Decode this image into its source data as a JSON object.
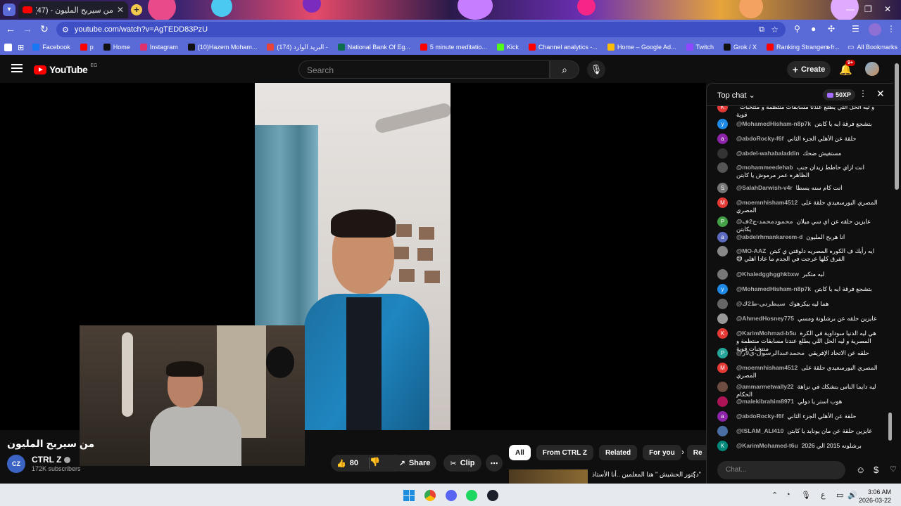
{
  "browser": {
    "tab_title": "من سيربح المليون - ube (47)",
    "url": "youtube.com/watch?v=AgTEDD83PzU",
    "bookmarks": [
      {
        "label": "Facebook",
        "color": "#1877f2"
      },
      {
        "label": "p",
        "color": "#ff0000"
      },
      {
        "label": "Home",
        "color": "#111111"
      },
      {
        "label": "Instagram",
        "color": "#e1306c"
      },
      {
        "label": "(10)Hazem Moham...",
        "color": "#111111"
      },
      {
        "label": "البريد الوارد (174) -",
        "color": "#ea4335"
      },
      {
        "label": "National Bank Of Eg...",
        "color": "#0b6e4f"
      },
      {
        "label": "5 minute meditatio...",
        "color": "#ff0000"
      },
      {
        "label": "Kick",
        "color": "#53fc18"
      },
      {
        "label": "Channel analytics -...",
        "color": "#ff0000"
      },
      {
        "label": "Home – Google Ad...",
        "color": "#fbbc05"
      },
      {
        "label": "Twitch",
        "color": "#9146ff"
      },
      {
        "label": "Grok / X",
        "color": "#111111"
      },
      {
        "label": "Ranking Strangers fr...",
        "color": "#ff0000"
      }
    ],
    "all_bookmarks": "All Bookmarks"
  },
  "youtube": {
    "logo_text": "YouTube",
    "country_code": "EG",
    "search_placeholder": "Search",
    "create_label": "Create",
    "notif_count": "9+"
  },
  "video": {
    "title": "من سيربح المليون",
    "channel_name": "CTRL Z",
    "channel_initials": "CZ",
    "subscribers": "172K subscribers",
    "likes": "80",
    "share_label": "Share",
    "clip_label": "Clip"
  },
  "chips": [
    "All",
    "From CTRL Z",
    "Related",
    "For you",
    "Re"
  ],
  "recommendation": {
    "title": "\"دكتور الحشيش \" هنا المعلمين ..أنا الأستاذ"
  },
  "chat": {
    "mode": "Top chat",
    "xp": "50XP",
    "input_placeholder": "Chat...",
    "messages": [
      {
        "user": "",
        "text": "و ليه الحل اللي يطلع عندنا مسابقات منتظمة و منتخبات قوية",
        "initial": "K",
        "color": "#e53935"
      },
      {
        "user": "@MohamedHisham-n8p7k",
        "text": "بتشجع فرقة ايه يا كابتن",
        "initial": "y",
        "color": "#1e88e5"
      },
      {
        "user": "@abdoRocky-f6f",
        "text": "حلقة عن الأهلي الجزء الثاني",
        "initial": "a",
        "color": "#8e24aa"
      },
      {
        "user": "@abdel-wahabaladdin",
        "text": "مستفيش ضحك",
        "initial": "",
        "color": "#333333"
      },
      {
        "user": "@mohammeedehab",
        "text": "انت ازاي حاطط زيدان جنب الظاهره عمر مرموش يا كابتن",
        "initial": "",
        "color": "#555555"
      },
      {
        "user": "@SalahDarwish-v4r",
        "text": "انت كام سنه يسطا",
        "initial": "S",
        "color": "#757575"
      },
      {
        "user": "@moemnhisham4512",
        "text": "المصري البورسعيدي حلقة على المصري",
        "initial": "M",
        "color": "#e53935"
      },
      {
        "user": "@محمودمحمد-ج2ف",
        "text": "عايزين حلقه عن اي سي ميلان يكابتن",
        "initial": "P",
        "color": "#43a047"
      },
      {
        "user": "@abdelrhmankareem-d",
        "text": "انا هربح المليون",
        "initial": "a",
        "color": "#5c6bc0"
      },
      {
        "user": "@MO-AAZ",
        "text": "ايه رأيك ف الكوره المصريه دلوقتي ي كبتن الفرق كلها عرجت في الجدم ما عادا اهلي 😅",
        "initial": "",
        "color": "#888888"
      },
      {
        "user": "@Khaledgghgghkbxw",
        "text": "ليه متكبر",
        "initial": "",
        "color": "#777777"
      },
      {
        "user": "@MohamedHisham-n8p7k",
        "text": "بتشجع فرقة ايه يا كابتن",
        "initial": "y",
        "color": "#1e88e5"
      },
      {
        "user": "@سيطرتي-ط2ك",
        "text": "هما ليه بيكرهوك",
        "initial": "",
        "color": "#666666"
      },
      {
        "user": "@AhmedHosney775",
        "text": "عايزين حلقه عن برشلونة ومسي",
        "initial": "",
        "color": "#999999"
      },
      {
        "user": "@KarimMohmad-b5u",
        "text": "هي ليه الدنيا سوداوية في الكرة المصرية و ليه الحل اللي يطلع عندنا مسابقات منتظمة و منتخبات قوية",
        "initial": "K",
        "color": "#e53935"
      },
      {
        "user": "@محمدعبدالرسول-ي9ر",
        "text": "حلقه عن الاتحاد الإفريقي",
        "initial": "P",
        "color": "#26a69a"
      },
      {
        "user": "@moemnhisham4512",
        "text": "المصري البورسعيدي حلقة على المصري",
        "initial": "M",
        "color": "#e53935"
      },
      {
        "user": "@ammarmetwally22",
        "text": "ليه دايما الناس بتشكك في نزاهة الحكام",
        "initial": "",
        "color": "#6d4c41"
      },
      {
        "user": "@malekibrahim8971",
        "text": "هوب استر يا دولي",
        "initial": "",
        "color": "#ad1457"
      },
      {
        "user": "@abdoRocky-f6f",
        "text": "حلقة عن الأهلي الجزء الثاني",
        "initial": "a",
        "color": "#8e24aa"
      },
      {
        "user": "@ISLAM_ALI410",
        "text": "عايزين حلقة عن مان يونايد يا كابتن",
        "initial": "",
        "color": "#4a6fa5"
      },
      {
        "user": "@KarimMohamed-t6u",
        "text": "برشلونه 2015 الي 2026",
        "initial": "K",
        "color": "#00897b"
      }
    ]
  },
  "taskbar": {
    "time": "3:06 AM",
    "date": "2026-03-22",
    "lang": "ع"
  }
}
